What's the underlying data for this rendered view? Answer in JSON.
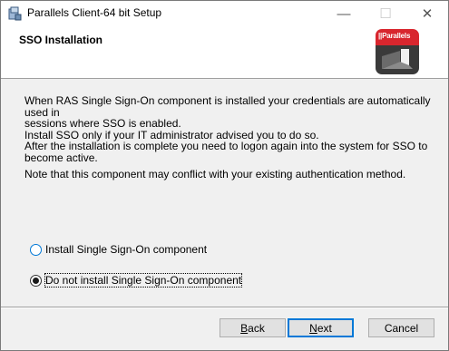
{
  "window": {
    "title": "Parallels Client-64 bit Setup",
    "controls": {
      "minimize": "—",
      "maximize": "☐",
      "close": "✕"
    }
  },
  "header": {
    "title": "SSO Installation",
    "logo_text": "||Parallels"
  },
  "body": {
    "description_lines": [
      "When RAS Single Sign-On component is installed your credentials are automatically used in",
      "sessions where SSO is enabled.",
      "Install SSO only if your IT administrator advised you to do so.",
      "After the installation is complete you need to logon again into the system for SSO to",
      "become active."
    ],
    "note": "Note that this component may conflict with your existing authentication method."
  },
  "options": [
    {
      "label": "Install Single Sign-On component",
      "selected": false
    },
    {
      "label": "Do not install Single Sign-On component",
      "selected": true
    }
  ],
  "footer": {
    "back_prefix": "",
    "back_accel": "B",
    "back_rest": "ack",
    "next_accel": "N",
    "next_rest": "ext",
    "cancel_label": "Cancel"
  },
  "colors": {
    "accent": "#0078d7",
    "brand_red": "#d8262e"
  }
}
